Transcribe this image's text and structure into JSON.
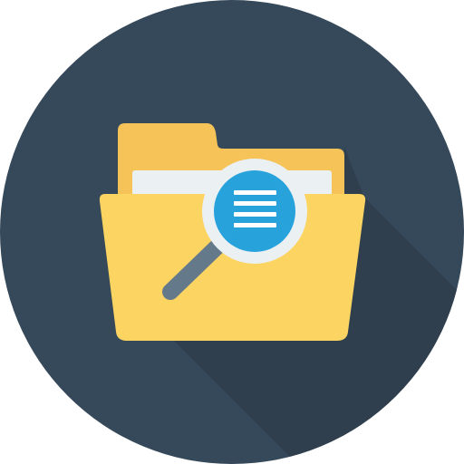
{
  "icon": {
    "name": "folder-search-icon",
    "depicts": [
      "folder-icon",
      "magnifying-glass-icon",
      "document-lines-icon"
    ]
  },
  "colors": {
    "circle_background": "#36495a",
    "long_shadow": "#2f3f4e",
    "folder_back": "#f6c358",
    "folder_front": "#fcd462",
    "paper": "#ebf0f3",
    "lens_ring": "#ebf0f3",
    "lens_glass": "#27a2db",
    "lens_lines": "#ffffff",
    "handle": "#64798a"
  }
}
